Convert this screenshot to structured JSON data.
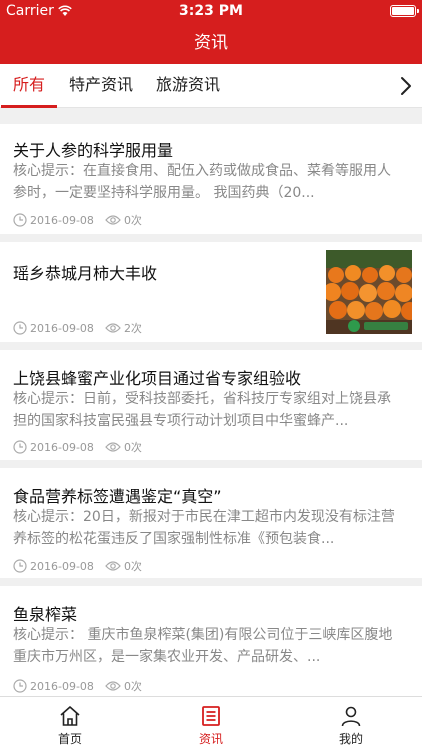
{
  "status_bar": {
    "carrier": "Carrier",
    "time": "3:23 PM"
  },
  "nav": {
    "title": "资讯"
  },
  "tabs": [
    {
      "label": "所有",
      "active": true
    },
    {
      "label": "特产资讯",
      "active": false
    },
    {
      "label": "旅游资讯",
      "active": false
    }
  ],
  "articles": [
    {
      "title": "关于人参的科学服用量",
      "summary_line1": "核心提示：在直接食用、配伍入药或做成食品、菜肴等服用人",
      "summary_line2": "参时，一定要坚持科学服用量。        我国药典（20...",
      "date": "2016-09-08",
      "views": "0次"
    },
    {
      "title": "瑶乡恭城月柿大丰收",
      "date": "2016-09-08",
      "views": "2次",
      "has_image": true
    },
    {
      "title": "上饶县蜂蜜产业化项目通过省专家组验收",
      "summary_line1": "核心提示：日前，受科技部委托，省科技厅专家组对上饶县承",
      "summary_line2": "担的国家科技富民强县专项行动计划项目中华蜜蜂产...",
      "date": "2016-09-08",
      "views": "0次"
    },
    {
      "title": "食品营养标签遭遇鉴定“真空”",
      "summary_line1": "核心提示：20日，新报对于市民在津工超市内发现没有标注营",
      "summary_line2": "养标签的松花蛋违反了国家强制性标准《预包装食...",
      "date": "2016-09-08",
      "views": "0次"
    },
    {
      "title": "鱼泉榨菜",
      "summary_line1": "核心提示：  重庆市鱼泉榨菜(集团)有限公司位于三峡库区腹地",
      "summary_line2": "重庆市万州区，是一家集农业开发、产品研发、...",
      "date": "2016-09-08",
      "views": "0次"
    }
  ],
  "tab_bar": [
    {
      "label": "首页",
      "icon": "home-icon",
      "active": false
    },
    {
      "label": "资讯",
      "icon": "news-icon",
      "active": true
    },
    {
      "label": "我的",
      "icon": "user-icon",
      "active": false
    }
  ],
  "colors": {
    "brand_red": "#d61e1e",
    "muted_text": "#888888",
    "background": "#f0f0f0"
  }
}
